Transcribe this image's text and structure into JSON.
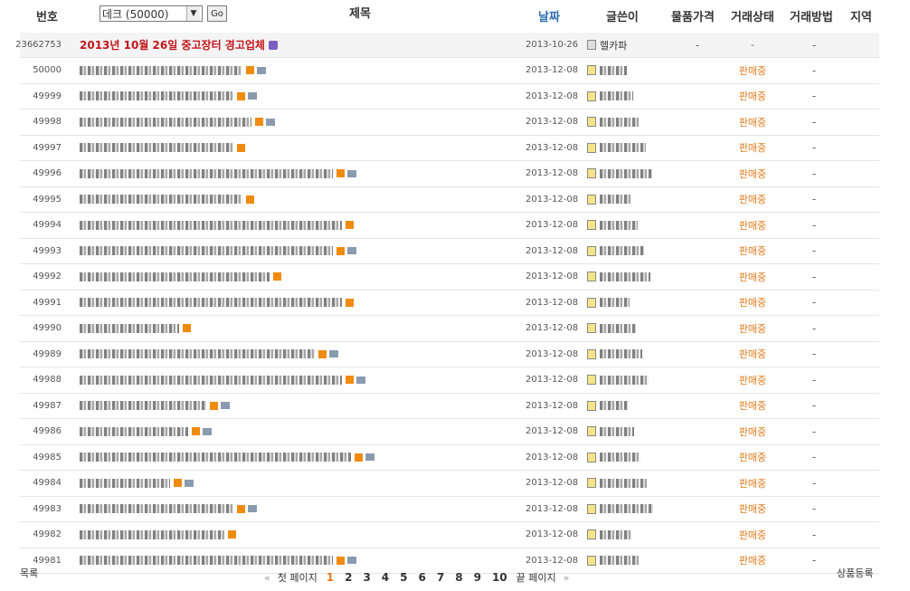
{
  "header": {
    "no_label": "번호",
    "category_value": "데크 (50000)",
    "go_label": "Go",
    "title_label": "제목",
    "date_label": "날짜",
    "writer_label": "글쓴이",
    "price_label": "물품가격",
    "status_label": "거래상태",
    "method_label": "거래방법",
    "region_label": "지역"
  },
  "notice": {
    "num": "23662753",
    "title": "2013년 10월 26일 중고장터 경고업체",
    "date": "2013-10-26",
    "writer": "헬카파",
    "price": "-",
    "status": "-",
    "method": "-"
  },
  "rows": [
    {
      "num": "50000",
      "date": "2013-12-08",
      "status": "판매중",
      "method": "-"
    },
    {
      "num": "49999",
      "date": "2013-12-08",
      "status": "판매중",
      "method": "-"
    },
    {
      "num": "49998",
      "date": "2013-12-08",
      "status": "판매중",
      "method": "-"
    },
    {
      "num": "49997",
      "date": "2013-12-08",
      "status": "판매중",
      "method": "-"
    },
    {
      "num": "49996",
      "date": "2013-12-08",
      "status": "판매중",
      "method": "-"
    },
    {
      "num": "49995",
      "date": "2013-12-08",
      "status": "판매중",
      "method": "-"
    },
    {
      "num": "49994",
      "date": "2013-12-08",
      "status": "판매중",
      "method": "-"
    },
    {
      "num": "49993",
      "date": "2013-12-08",
      "status": "판매중",
      "method": "-"
    },
    {
      "num": "49992",
      "date": "2013-12-08",
      "status": "판매중",
      "method": "-"
    },
    {
      "num": "49991",
      "date": "2013-12-08",
      "status": "판매중",
      "method": "-"
    },
    {
      "num": "49990",
      "date": "2013-12-08",
      "status": "판매중",
      "method": "-"
    },
    {
      "num": "49989",
      "date": "2013-12-08",
      "status": "판매중",
      "method": "-"
    },
    {
      "num": "49988",
      "date": "2013-12-08",
      "status": "판매중",
      "method": "-"
    },
    {
      "num": "49987",
      "date": "2013-12-08",
      "status": "판매중",
      "method": "-"
    },
    {
      "num": "49986",
      "date": "2013-12-08",
      "status": "판매중",
      "method": "-"
    },
    {
      "num": "49985",
      "date": "2013-12-08",
      "status": "판매중",
      "method": "-"
    },
    {
      "num": "49984",
      "date": "2013-12-08",
      "status": "판매중",
      "method": "-"
    },
    {
      "num": "49983",
      "date": "2013-12-08",
      "status": "판매중",
      "method": "-"
    },
    {
      "num": "49982",
      "date": "2013-12-08",
      "status": "판매중",
      "method": "-"
    },
    {
      "num": "49981",
      "date": "2013-12-08",
      "status": "판매중",
      "method": "-"
    }
  ],
  "footer": {
    "list_label": "목록",
    "first_label": "첫 페이지",
    "last_label": "끝 페이지",
    "pages": [
      "1",
      "2",
      "3",
      "4",
      "5",
      "6",
      "7",
      "8",
      "9",
      "10"
    ],
    "current_page": "1",
    "register_label": "상품등록"
  }
}
